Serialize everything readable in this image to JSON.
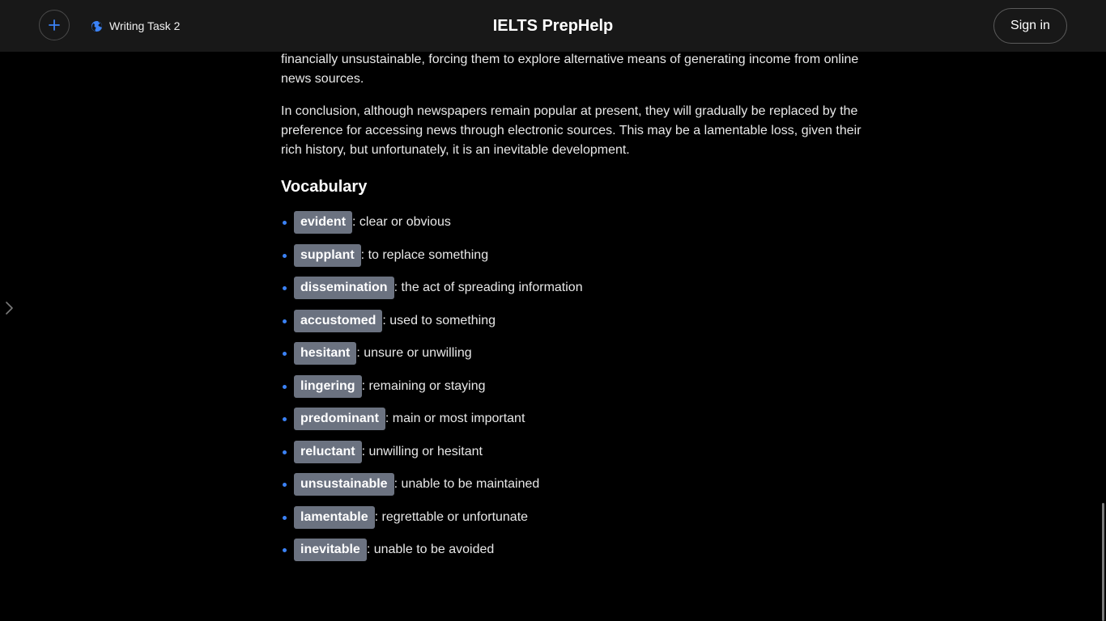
{
  "header": {
    "title": "IELTS PrepHelp",
    "task_label": "Writing Task 2",
    "signin_label": "Sign in",
    "accent_color": "#3b82f6"
  },
  "article": {
    "paragraph_partial": "financially unsustainable, forcing them to explore alternative means of generating income from online news sources.",
    "conclusion": "In conclusion, although newspapers remain popular at present, they will gradually be replaced by the preference for accessing news through electronic sources. This may be a lamentable loss, given their rich history, but unfortunately, it is an inevitable development."
  },
  "vocabulary": {
    "heading": "Vocabulary",
    "items": [
      {
        "term": "evident",
        "definition": ": clear or obvious"
      },
      {
        "term": "supplant",
        "definition": ": to replace something"
      },
      {
        "term": "dissemination",
        "definition": ": the act of spreading information"
      },
      {
        "term": "accustomed",
        "definition": ": used to something"
      },
      {
        "term": "hesitant",
        "definition": ": unsure or unwilling"
      },
      {
        "term": "lingering",
        "definition": ": remaining or staying"
      },
      {
        "term": "predominant",
        "definition": ": main or most important"
      },
      {
        "term": "reluctant",
        "definition": ": unwilling or hesitant"
      },
      {
        "term": "unsustainable",
        "definition": ": unable to be maintained"
      },
      {
        "term": "lamentable",
        "definition": ": regrettable or unfortunate"
      },
      {
        "term": "inevitable",
        "definition": ": unable to be avoided"
      }
    ]
  },
  "icons": {
    "new": "plus-icon",
    "task": "globe-icon",
    "sidebar": "chevron-right-icon"
  }
}
